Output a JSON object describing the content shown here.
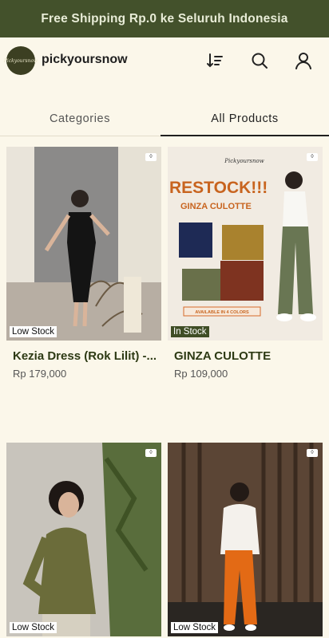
{
  "promo": {
    "text": "Free Shipping Rp.0 ke Seluruh Indonesia"
  },
  "header": {
    "logo_text": "Pickyoursnow",
    "brand": "pickyoursnow",
    "icons": [
      "sort-icon",
      "search-icon",
      "user-icon"
    ]
  },
  "tabs": [
    {
      "label": "Categories",
      "active": false
    },
    {
      "label": "All Products",
      "active": true
    }
  ],
  "colors": {
    "accent": "#43512b",
    "background": "#fbf7ea"
  },
  "products": [
    {
      "name": "Kezia Dress (Rok Lilit) -...",
      "price": "Rp 179,000",
      "stock": "Low Stock"
    },
    {
      "name": "GINZA CULOTTE",
      "price": "Rp 109,000",
      "stock": "In Stock",
      "image_text": {
        "brand": "Pickyoursnow",
        "headline": "RESTOCK!!!",
        "sub": "GINZA CULOTTE",
        "note": "AVAILABLE IN 4 COLORS"
      }
    },
    {
      "name": "",
      "price": "",
      "stock": "Low Stock"
    },
    {
      "name": "",
      "price": "",
      "stock": "Low Stock"
    }
  ]
}
